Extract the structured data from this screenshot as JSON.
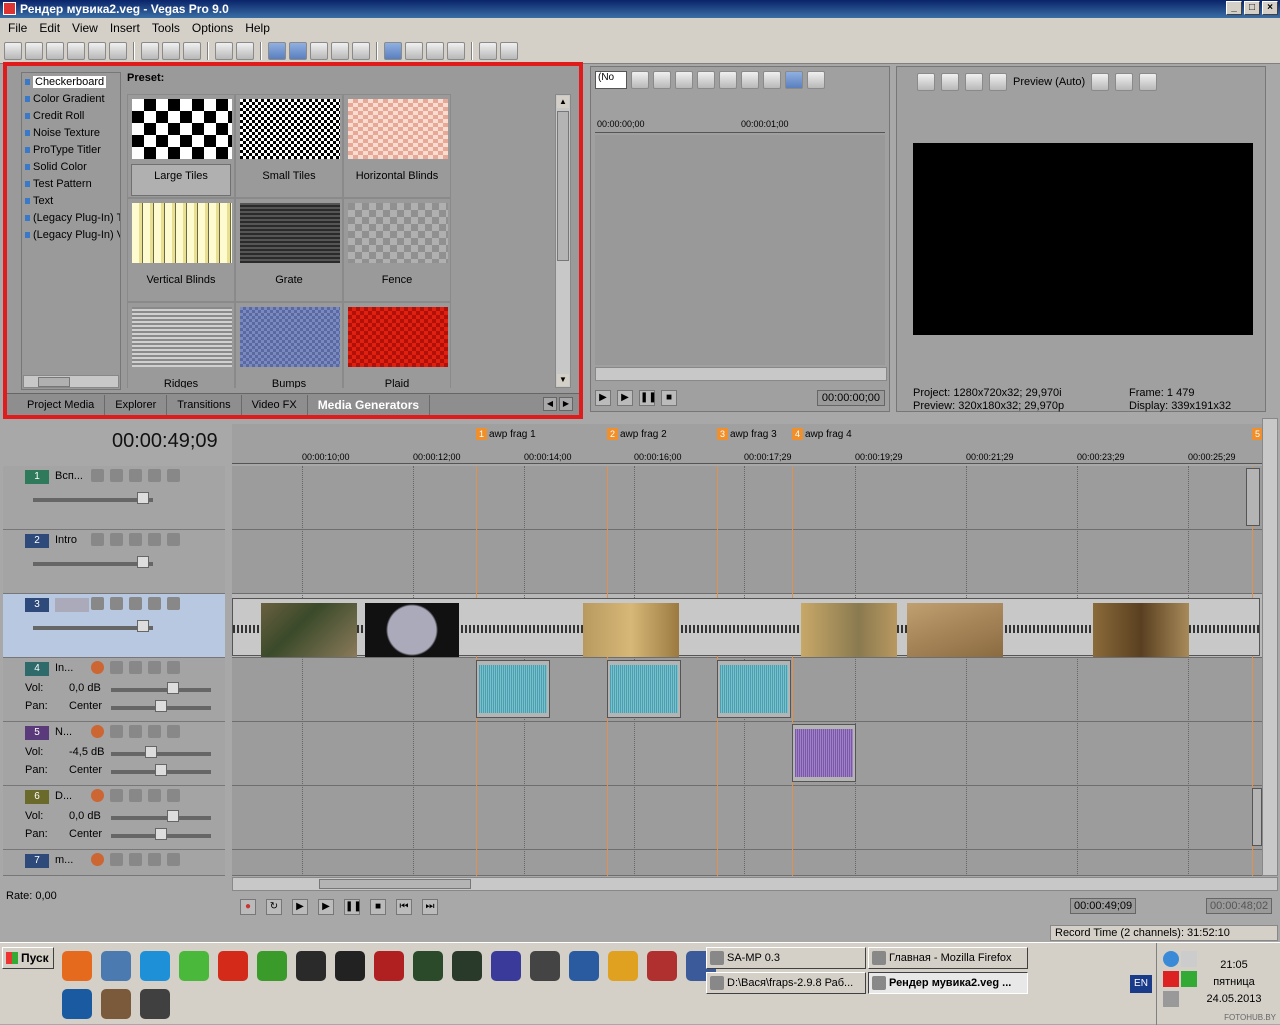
{
  "window": {
    "title": "Рендер мувика2.veg - Vegas Pro 9.0",
    "min": "_",
    "max": "□",
    "close": "×"
  },
  "menu": [
    "File",
    "Edit",
    "View",
    "Insert",
    "Tools",
    "Options",
    "Help"
  ],
  "media_generators": {
    "list": [
      "Checkerboard",
      "Color Gradient",
      "Credit Roll",
      "Noise Texture",
      "ProType Titler",
      "Solid Color",
      "Test Pattern",
      "Text",
      "(Legacy Plug-In) T",
      "(Legacy Plug-In) V"
    ],
    "preset_label": "Preset:",
    "presets": [
      "Large Tiles",
      "Small Tiles",
      "Horizontal Blinds",
      "Vertical Blinds",
      "Grate",
      "Fence",
      "Ridges",
      "Bumps",
      "Plaid"
    ],
    "tabs": [
      "Project Media",
      "Explorer",
      "Transitions",
      "Video FX",
      "Media Generators"
    ],
    "active_tab": "Media Generators"
  },
  "trimmer": {
    "dropdown": "(No",
    "ruler": [
      "00:00:00;00",
      "00:00:01;00"
    ],
    "timecode": "00:00:00;00"
  },
  "preview": {
    "mode": "Preview (Auto)",
    "project_label": "Project:",
    "project_value": "1280x720x32; 29,970i",
    "preview_label": "Preview:",
    "preview_value": "320x180x32; 29,970p",
    "frame_label": "Frame:",
    "frame_value": "1 479",
    "display_label": "Display:",
    "display_value": "339x191x32"
  },
  "timeline": {
    "time": "00:00:49;09",
    "markers": [
      {
        "n": "1",
        "label": "awp frag 1"
      },
      {
        "n": "2",
        "label": "awp frag 2"
      },
      {
        "n": "3",
        "label": "awp frag 3"
      },
      {
        "n": "4",
        "label": "awp frag 4"
      },
      {
        "n": "5",
        "label": ""
      }
    ],
    "ruler": [
      "00:00:10;00",
      "00:00:12;00",
      "00:00:14;00",
      "00:00:16;00",
      "00:00:17;29",
      "00:00:19;29",
      "00:00:21;29",
      "00:00:23;29",
      "00:00:25;29"
    ],
    "tracks": [
      {
        "num": "1",
        "name": "Всп...",
        "type": "video"
      },
      {
        "num": "2",
        "name": "Intro",
        "type": "video"
      },
      {
        "num": "3",
        "name": "",
        "type": "video"
      },
      {
        "num": "4",
        "name": "In...",
        "type": "audio",
        "vol": "0,0 dB",
        "pan": "Center"
      },
      {
        "num": "5",
        "name": "N...",
        "type": "audio",
        "vol": "-4,5 dB",
        "pan": "Center"
      },
      {
        "num": "6",
        "name": "D...",
        "type": "audio",
        "vol": "0,0 dB",
        "pan": "Center"
      },
      {
        "num": "7",
        "name": "m...",
        "type": "audio"
      }
    ],
    "vol_label": "Vol:",
    "pan_label": "Pan:",
    "rate": "Rate: 0,00",
    "tc_current": "00:00:49;09",
    "tc_end": "00:00:48;02",
    "record_time": "Record Time (2 channels): 31:52:10"
  },
  "taskbar": {
    "start": "Пуск",
    "tasks": [
      "SA-MP 0.3",
      "Главная - Mozilla Firefox",
      "D:\\Вася\\fraps-2.9.8 Раб...",
      "Рендер мувика2.veg ..."
    ],
    "lang": "EN",
    "time": "21:05",
    "day": "пятница",
    "date": "24.05.2013",
    "quick_colors": [
      "#e66a1e",
      "#4a7ab0",
      "#1e90d8",
      "#4ab83a",
      "#d42a1a",
      "#3a9a2a",
      "#2a2a2a",
      "#222222",
      "#b02020",
      "#2a4a2a",
      "#2a3a2a",
      "#3a3a9a",
      "#444444",
      "#2a5aa0",
      "#e0a020",
      "#b03030",
      "#3a5a9a",
      "#1a5aa0",
      "#7a5a3a",
      "#404040"
    ]
  },
  "watermark": "FOTOHUB.BY"
}
